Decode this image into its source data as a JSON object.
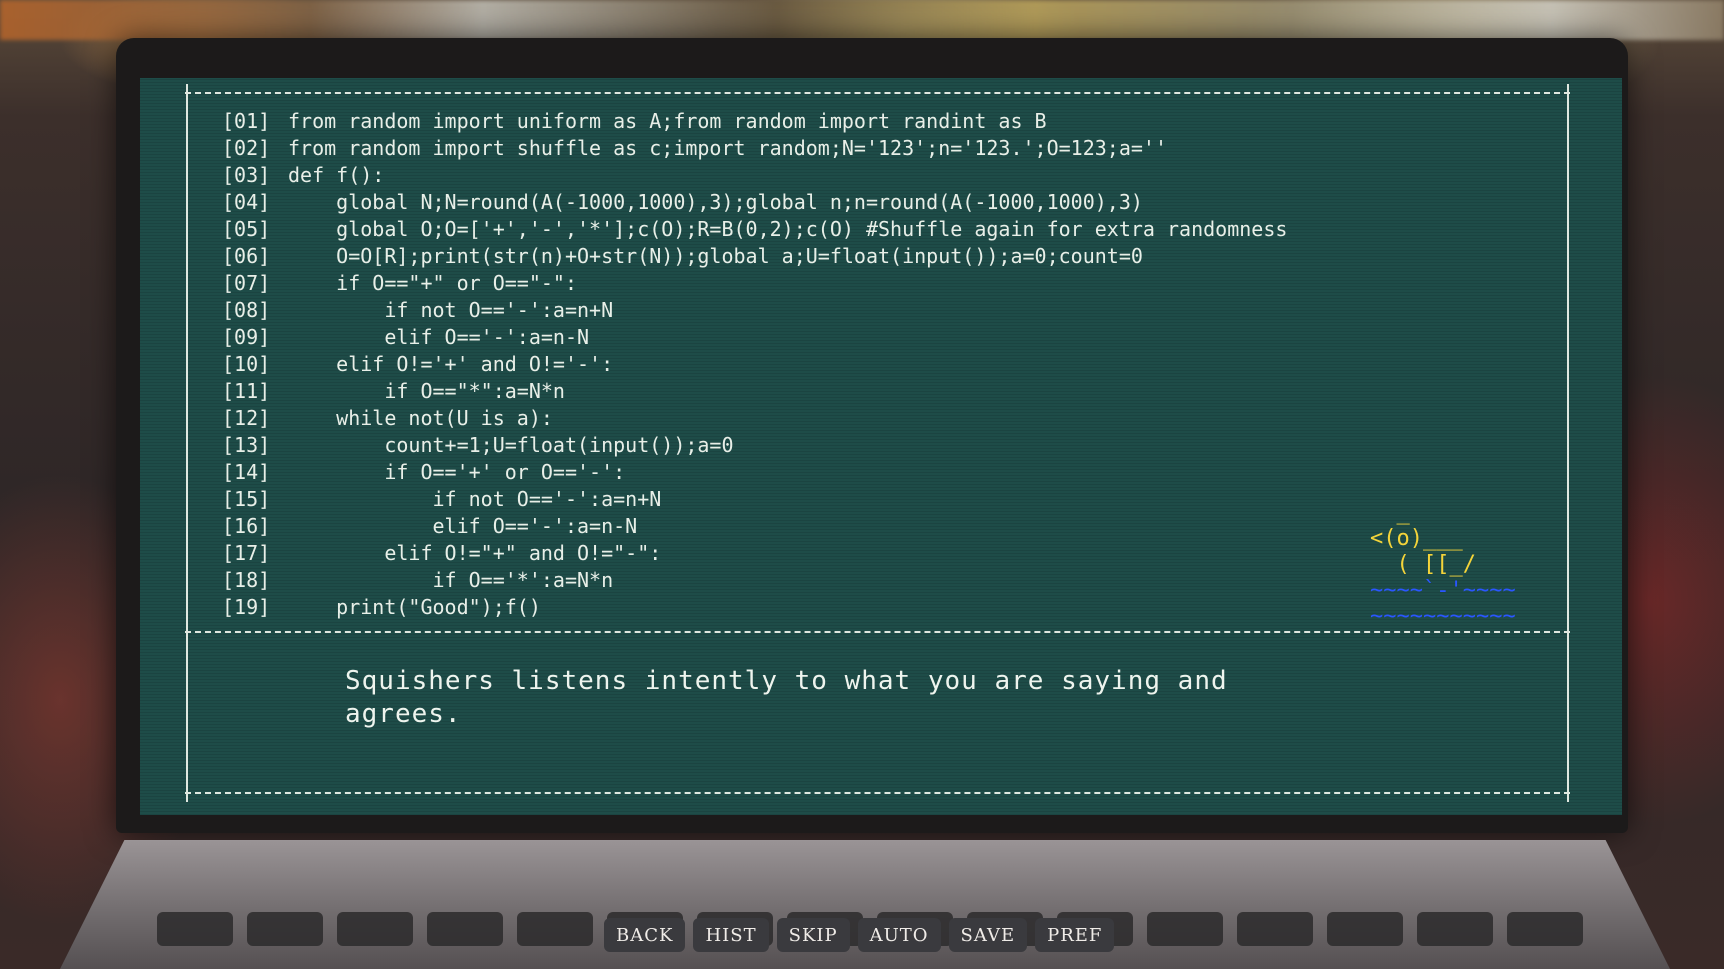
{
  "code_lines": [
    {
      "num": "01",
      "text": "from random import uniform as A;from random import randint as B"
    },
    {
      "num": "02",
      "text": "from random import shuffle as c;import random;N='123';n='123.';O=123;a=''"
    },
    {
      "num": "03",
      "text": "def f():"
    },
    {
      "num": "04",
      "text": "    global N;N=round(A(-1000,1000),3);global n;n=round(A(-1000,1000),3)"
    },
    {
      "num": "05",
      "text": "    global O;O=['+','-','*'];c(O);R=B(0,2);c(O) #Shuffle again for extra randomness"
    },
    {
      "num": "06",
      "text": "    O=O[R];print(str(n)+O+str(N));global a;U=float(input());a=0;count=0"
    },
    {
      "num": "07",
      "text": "    if O==\"+\" or O==\"-\":"
    },
    {
      "num": "08",
      "text": "        if not O=='-':a=n+N"
    },
    {
      "num": "09",
      "text": "        elif O=='-':a=n-N"
    },
    {
      "num": "10",
      "text": "    elif O!='+' and O!='-':"
    },
    {
      "num": "11",
      "text": "        if O==\"*\":a=N*n"
    },
    {
      "num": "12",
      "text": "    while not(U is a):"
    },
    {
      "num": "13",
      "text": "        count+=1;U=float(input());a=0"
    },
    {
      "num": "14",
      "text": "        if O=='+' or O=='-':"
    },
    {
      "num": "15",
      "text": "            if not O=='-':a=n+N"
    },
    {
      "num": "16",
      "text": "            elif O=='-':a=n-N"
    },
    {
      "num": "17",
      "text": "        elif O!=\"+\" and O!=\"-\":"
    },
    {
      "num": "18",
      "text": "            if O=='*':a=N*n"
    },
    {
      "num": "19",
      "text": "    print(\"Good\");f()"
    }
  ],
  "dialogue": {
    "text": "Squishers listens intently to what you are saying and agrees."
  },
  "duck_art": {
    "line1": "  _",
    "line2": "<(o)___",
    "line3": "  ( [[_/",
    "water1": "~~~~`-'~~~~",
    "water2": "~~~~~~~~~~~"
  },
  "quick_menu": [
    "BACK",
    "HIST",
    "SKIP",
    "AUTO",
    "SAVE",
    "PREF"
  ],
  "colors": {
    "screen_bg": "#1e4c48",
    "terminal_text": "#e8efe8",
    "duck_yellow": "#f4d43a",
    "water_blue": "#2a56ff"
  }
}
